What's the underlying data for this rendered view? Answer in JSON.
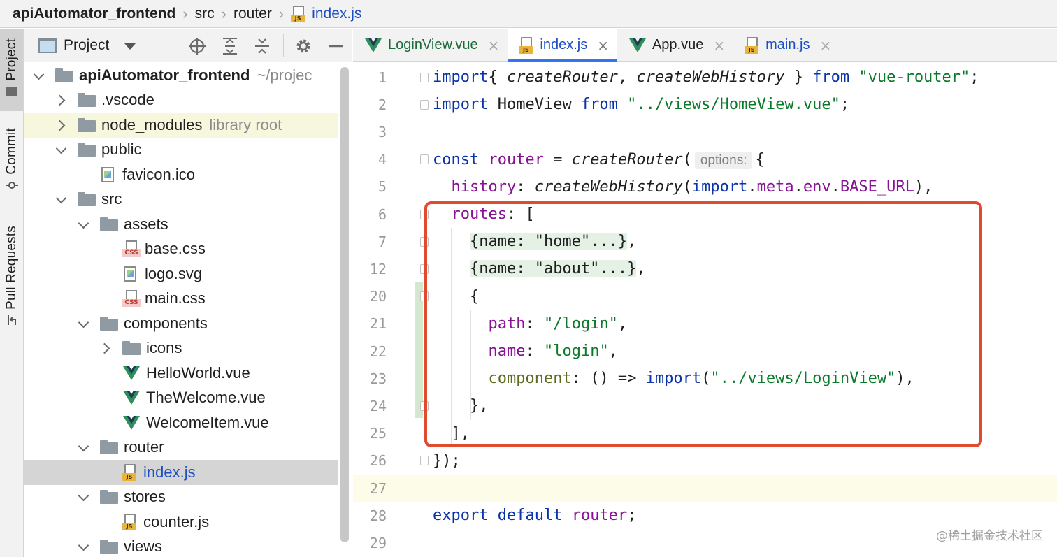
{
  "breadcrumb": {
    "items": [
      "apiAutomator_frontend",
      "src",
      "router",
      "index.js"
    ]
  },
  "toolstrip": {
    "project_label": "Project",
    "commit_label": "Commit",
    "pull_requests_label": "Pull Requests"
  },
  "project_panel": {
    "title": "Project",
    "tree": [
      {
        "label": "apiAutomator_frontend",
        "hint": "~/projec",
        "kind": "folder",
        "chevron": "down",
        "indent": 0,
        "bold": true
      },
      {
        "label": ".vscode",
        "hint": "",
        "kind": "folder",
        "chevron": "right",
        "indent": 1
      },
      {
        "label": "node_modules",
        "hint": "library root",
        "kind": "folder",
        "chevron": "right",
        "indent": 1,
        "library": true
      },
      {
        "label": "public",
        "hint": "",
        "kind": "folder",
        "chevron": "down",
        "indent": 1
      },
      {
        "label": "favicon.ico",
        "hint": "",
        "kind": "image",
        "chevron": "none",
        "indent": 2
      },
      {
        "label": "src",
        "hint": "",
        "kind": "folder",
        "chevron": "down",
        "indent": 1
      },
      {
        "label": "assets",
        "hint": "",
        "kind": "folder",
        "chevron": "down",
        "indent": 2
      },
      {
        "label": "base.css",
        "hint": "",
        "kind": "css",
        "chevron": "none",
        "indent": 3
      },
      {
        "label": "logo.svg",
        "hint": "",
        "kind": "image",
        "chevron": "none",
        "indent": 3
      },
      {
        "label": "main.css",
        "hint": "",
        "kind": "css",
        "chevron": "none",
        "indent": 3
      },
      {
        "label": "components",
        "hint": "",
        "kind": "folder",
        "chevron": "down",
        "indent": 2
      },
      {
        "label": "icons",
        "hint": "",
        "kind": "folder",
        "chevron": "right",
        "indent": 3
      },
      {
        "label": "HelloWorld.vue",
        "hint": "",
        "kind": "vue",
        "chevron": "none",
        "indent": 3
      },
      {
        "label": "TheWelcome.vue",
        "hint": "",
        "kind": "vue",
        "chevron": "none",
        "indent": 3
      },
      {
        "label": "WelcomeItem.vue",
        "hint": "",
        "kind": "vue",
        "chevron": "none",
        "indent": 3
      },
      {
        "label": "router",
        "hint": "",
        "kind": "folder",
        "chevron": "down",
        "indent": 2
      },
      {
        "label": "index.js",
        "hint": "",
        "kind": "js",
        "chevron": "none",
        "indent": 3,
        "selected": true
      },
      {
        "label": "stores",
        "hint": "",
        "kind": "folder",
        "chevron": "down",
        "indent": 2
      },
      {
        "label": "counter.js",
        "hint": "",
        "kind": "js",
        "chevron": "none",
        "indent": 3
      },
      {
        "label": "views",
        "hint": "",
        "kind": "folder",
        "chevron": "down",
        "indent": 2
      }
    ]
  },
  "editor": {
    "tabs": [
      {
        "label": "LoginView.vue",
        "kind": "vue",
        "active": false
      },
      {
        "label": "index.js",
        "kind": "js",
        "active": true
      },
      {
        "label": "App.vue",
        "kind": "vue",
        "active": false
      },
      {
        "label": "main.js",
        "kind": "js",
        "active": false
      }
    ],
    "lines": [
      {
        "n": "1",
        "tokens": [
          [
            "kw",
            "import"
          ],
          [
            "",
            "{ "
          ],
          [
            "fn",
            "createRouter"
          ],
          [
            "",
            ", "
          ],
          [
            "fn",
            "createWebHistory"
          ],
          [
            "",
            " } "
          ],
          [
            "kw",
            "from"
          ],
          [
            "",
            " "
          ],
          [
            "str",
            "\"vue-router\""
          ],
          [
            "",
            ";"
          ]
        ]
      },
      {
        "n": "2",
        "tokens": [
          [
            "kw",
            "import"
          ],
          [
            "",
            " HomeView "
          ],
          [
            "kw",
            "from"
          ],
          [
            "",
            " "
          ],
          [
            "str",
            "\"../views/HomeView.vue\""
          ],
          [
            "",
            ";"
          ]
        ]
      },
      {
        "n": "3",
        "tokens": []
      },
      {
        "n": "4",
        "tokens": [
          [
            "kw",
            "const"
          ],
          [
            "",
            " "
          ],
          [
            "purple-id",
            "router"
          ],
          [
            "",
            " = "
          ],
          [
            "fn",
            "createRouter"
          ],
          [
            "",
            "("
          ],
          [
            "hint",
            "options:"
          ],
          [
            "",
            "{"
          ]
        ]
      },
      {
        "n": "5",
        "tokens": [
          [
            "",
            "  "
          ],
          [
            "prop",
            "history"
          ],
          [
            "",
            ": "
          ],
          [
            "fn",
            "createWebHistory"
          ],
          [
            "",
            "("
          ],
          [
            "kw",
            "import"
          ],
          [
            "",
            "."
          ],
          [
            "prop",
            "meta"
          ],
          [
            "",
            "."
          ],
          [
            "prop",
            "env"
          ],
          [
            "",
            "."
          ],
          [
            "prop",
            "BASE_URL"
          ],
          [
            "",
            "),"
          ]
        ]
      },
      {
        "n": "6",
        "tokens": [
          [
            "",
            "  "
          ],
          [
            "prop",
            "routes"
          ],
          [
            "",
            ": ["
          ]
        ]
      },
      {
        "n": "7",
        "tokens": [
          [
            "",
            "    "
          ],
          [
            "fold",
            "{name: \"home\"...}"
          ],
          [
            "",
            ","
          ]
        ]
      },
      {
        "n": "12",
        "tokens": [
          [
            "",
            "    "
          ],
          [
            "fold",
            "{name: \"about\"...}"
          ],
          [
            "",
            ","
          ]
        ]
      },
      {
        "n": "20",
        "tokens": [
          [
            "",
            "    {"
          ]
        ]
      },
      {
        "n": "21",
        "tokens": [
          [
            "",
            "      "
          ],
          [
            "prop",
            "path"
          ],
          [
            "",
            ": "
          ],
          [
            "str",
            "\"/login\""
          ],
          [
            "",
            ","
          ]
        ]
      },
      {
        "n": "22",
        "tokens": [
          [
            "",
            "      "
          ],
          [
            "prop",
            "name"
          ],
          [
            "",
            ": "
          ],
          [
            "str",
            "\"login\""
          ],
          [
            "",
            ","
          ]
        ]
      },
      {
        "n": "23",
        "tokens": [
          [
            "",
            "      "
          ],
          [
            "olive",
            "component"
          ],
          [
            "",
            ": () => "
          ],
          [
            "kw",
            "import"
          ],
          [
            "",
            "("
          ],
          [
            "str",
            "\"../views/LoginView\""
          ],
          [
            "",
            "),"
          ]
        ]
      },
      {
        "n": "24",
        "tokens": [
          [
            "",
            "    },"
          ]
        ]
      },
      {
        "n": "25",
        "tokens": [
          [
            "",
            "  ],"
          ]
        ]
      },
      {
        "n": "26",
        "tokens": [
          [
            "",
            "});"
          ]
        ]
      },
      {
        "n": "27",
        "tokens": []
      },
      {
        "n": "28",
        "tokens": [
          [
            "kw",
            "export"
          ],
          [
            "",
            " "
          ],
          [
            "kw",
            "default"
          ],
          [
            "",
            " "
          ],
          [
            "purple-id",
            "router"
          ],
          [
            "",
            ";"
          ]
        ]
      },
      {
        "n": "29",
        "tokens": []
      }
    ]
  },
  "watermark": "@稀土掘金技术社区",
  "colors": {
    "keyword": "#0b33a8",
    "string": "#0b7a2b",
    "property": "#871094",
    "highlight_box": "#e04a2f",
    "active_tab_underline": "#3574f0"
  }
}
